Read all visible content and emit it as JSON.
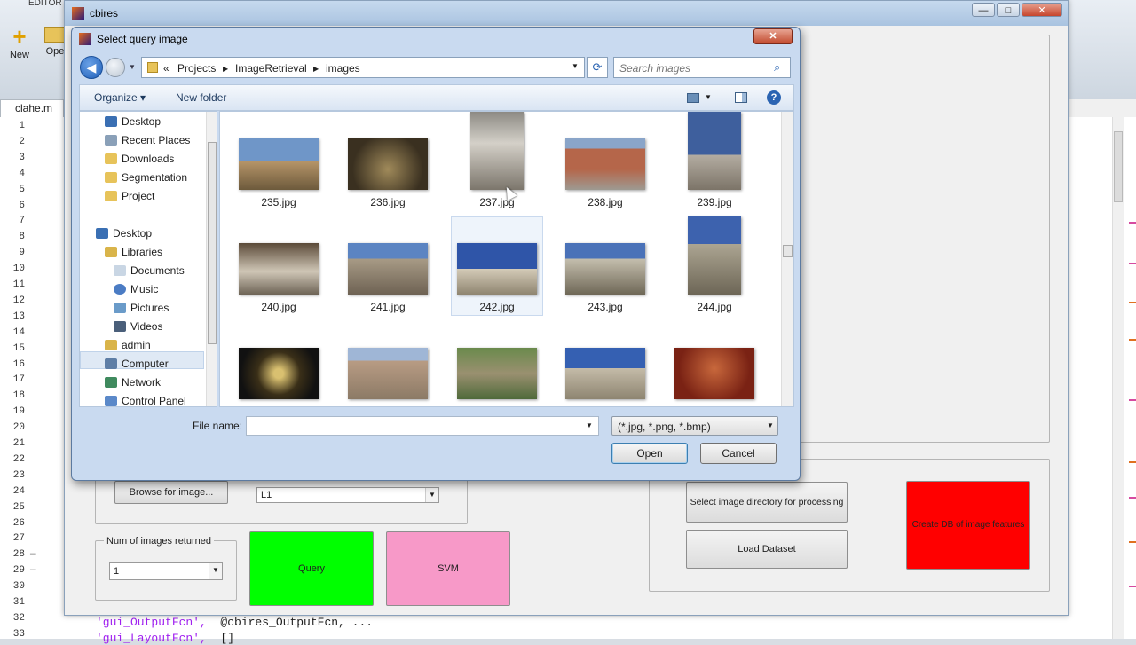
{
  "editor": {
    "tab_label": "EDITOR",
    "toolbar": {
      "new_label": "New",
      "open_label": "Ope"
    },
    "file_tab": "clahe.m",
    "line_numbers": [
      "1",
      "2",
      "3",
      "4",
      "5",
      "6",
      "7",
      "8",
      "9",
      "10",
      "11",
      "12",
      "13",
      "14",
      "15",
      "16",
      "17",
      "18",
      "19",
      "20",
      "21",
      "22",
      "23",
      "24",
      "25",
      "26",
      "27",
      "28",
      "29",
      "30",
      "31",
      "32",
      "33"
    ],
    "code_line_32": {
      "str": "'gui_OutputFcn',",
      "rest": "  @cbires_OutputFcn, ..."
    },
    "code_line_33": {
      "str": "'gui_LayoutFcn',",
      "rest": "  []"
    }
  },
  "gui": {
    "title": "cbires",
    "controls": {
      "minimize": "—",
      "maximize": "□",
      "close": "✕"
    },
    "browse_button": "Browse for image...",
    "metric_select": "L1",
    "num_images_label": "Num of images returned",
    "num_images_select": "1",
    "query_button": "Query",
    "svm_button": "SVM",
    "select_dir_button": "Select image directory for processing",
    "load_dataset_button": "Load Dataset",
    "create_db_button": "Create DB of image features",
    "colors": {
      "query": "#00ff00",
      "svm": "#f799c8",
      "create_db": "#ff0000"
    }
  },
  "dialog": {
    "title": "Select query image",
    "close": "✕",
    "breadcrumb": [
      "«",
      "Projects",
      "ImageRetrieval",
      "images"
    ],
    "search_placeholder": "Search images",
    "toolbar": {
      "organize": "Organize ▾",
      "new_folder": "New folder"
    },
    "nav": {
      "favorites": [
        "Desktop",
        "Recent Places",
        "Downloads",
        "Segmentation",
        "Project"
      ],
      "desktop": "Desktop",
      "libraries": "Libraries",
      "library_items": [
        "Documents",
        "Music",
        "Pictures",
        "Videos"
      ],
      "admin": "admin",
      "computer": "Computer",
      "network": "Network",
      "control_panel": "Control Panel"
    },
    "files": [
      {
        "name": "235.jpg"
      },
      {
        "name": "236.jpg"
      },
      {
        "name": "237.jpg"
      },
      {
        "name": "238.jpg"
      },
      {
        "name": "239.jpg"
      },
      {
        "name": "240.jpg"
      },
      {
        "name": "241.jpg"
      },
      {
        "name": "242.jpg"
      },
      {
        "name": "243.jpg"
      },
      {
        "name": "244.jpg"
      },
      {
        "name": ""
      },
      {
        "name": ""
      },
      {
        "name": ""
      },
      {
        "name": ""
      },
      {
        "name": ""
      }
    ],
    "file_name_label": "File name:",
    "file_name_value": "",
    "file_type": "(*.jpg, *.png, *.bmp)",
    "open_button": "Open",
    "cancel_button": "Cancel"
  }
}
